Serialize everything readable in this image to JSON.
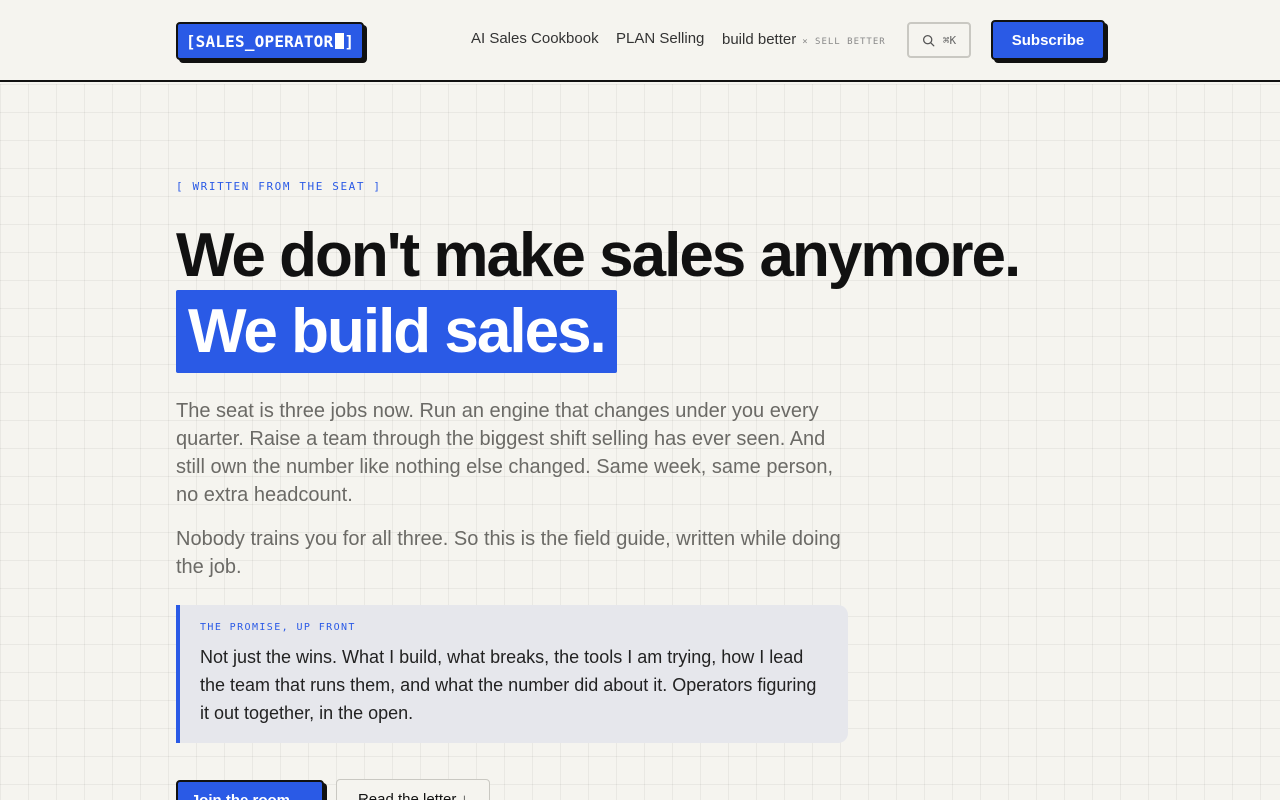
{
  "header": {
    "logo_text": "[SALES_OPERATOR",
    "logo_close": "]",
    "nav": [
      {
        "label": "AI Sales Cookbook"
      },
      {
        "label": "PLAN Selling"
      },
      {
        "label": "build better",
        "sub": "× SELL BETTER"
      }
    ],
    "search_shortcut": "⌘K",
    "subscribe_label": "Subscribe"
  },
  "hero": {
    "eyebrow": "[ WRITTEN FROM THE SEAT ]",
    "title_line1": "We don't make sales anymore.",
    "title_line2": "We build sales.",
    "paragraph1": "The seat is three jobs now. Run an engine that changes under you every quarter. Raise a team through the biggest shift selling has ever seen. And still own the number like nothing else changed. Same week, same person, no extra headcount.",
    "paragraph2": "Nobody trains you for all three. So this is the field guide, written while doing the job.",
    "callout_label": "THE PROMISE, UP FRONT",
    "callout_body": "Not just the wins. What I build, what breaks, the tools I am trying, how I lead the team that runs them, and what the number did about it. Operators figuring it out together, in the open.",
    "cta_primary": "Join the room →",
    "cta_secondary": "Read the letter ↓"
  },
  "colors": {
    "accent": "#2a5ae6",
    "background": "#f5f4ef",
    "ink": "#111111"
  }
}
